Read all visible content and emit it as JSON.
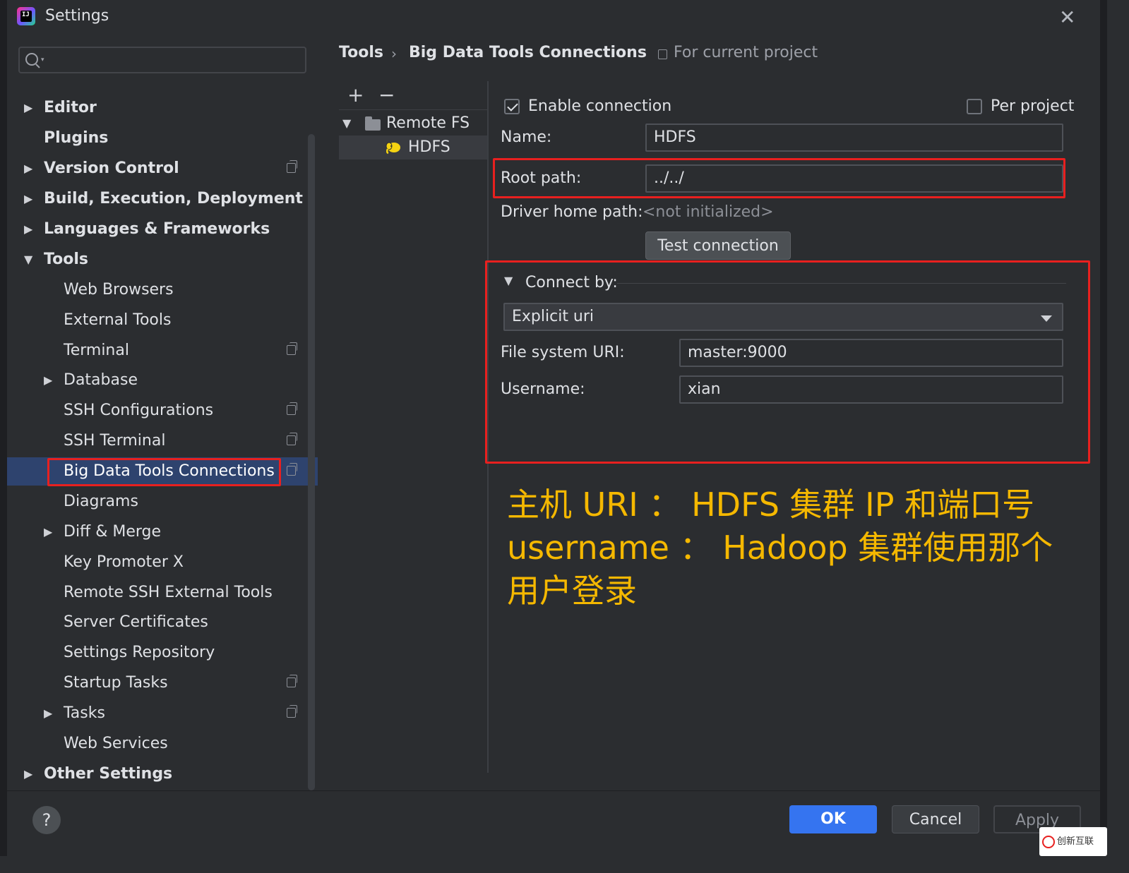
{
  "window": {
    "title": "Settings",
    "app_icon_text": "IJ"
  },
  "search": {
    "value": ""
  },
  "sidebar": {
    "items": [
      {
        "label": "Editor"
      },
      {
        "label": "Plugins"
      },
      {
        "label": "Version Control"
      },
      {
        "label": "Build, Execution, Deployment"
      },
      {
        "label": "Languages & Frameworks"
      },
      {
        "label": "Tools"
      },
      {
        "label": "Web Browsers"
      },
      {
        "label": "External Tools"
      },
      {
        "label": "Terminal"
      },
      {
        "label": "Database"
      },
      {
        "label": "SSH Configurations"
      },
      {
        "label": "SSH Terminal"
      },
      {
        "label": "Big Data Tools Connections"
      },
      {
        "label": "Diagrams"
      },
      {
        "label": "Diff & Merge"
      },
      {
        "label": "Key Promoter X"
      },
      {
        "label": "Remote SSH External Tools"
      },
      {
        "label": "Server Certificates"
      },
      {
        "label": "Settings Repository"
      },
      {
        "label": "Startup Tasks"
      },
      {
        "label": "Tasks"
      },
      {
        "label": "Web Services"
      },
      {
        "label": "Other Settings"
      }
    ]
  },
  "breadcrumb": {
    "parent": "Tools",
    "separator": "›",
    "current": "Big Data Tools Connections",
    "scope": "For current project"
  },
  "connections": {
    "add": "+",
    "remove": "−",
    "group": "Remote FS",
    "item": "HDFS"
  },
  "form": {
    "enable_label": "Enable connection",
    "per_project_label": "Per project",
    "name_label": "Name:",
    "name_value": "HDFS",
    "root_path_label": "Root path:",
    "root_path_value": "../../",
    "driver_label": "Driver home path:",
    "driver_value": "<not initialized>",
    "test_button": "Test connection",
    "connect_by_label": "Connect by:",
    "connect_by_value": "Explicit uri",
    "fs_uri_label": "File system URI:",
    "fs_uri_value": "master:9000",
    "username_label": "Username:",
    "username_value": "xian"
  },
  "annotation": {
    "line1": "主机 URI ： HDFS 集群 IP 和端口号",
    "line2": "username ：  Hadoop 集群使用那个",
    "line3": "用户登录"
  },
  "footer": {
    "help": "?",
    "ok": "OK",
    "cancel": "Cancel",
    "apply": "Apply"
  },
  "watermark": {
    "text": "创新互联"
  },
  "colors": {
    "accent": "#3574f0",
    "highlight": "#e8201f",
    "annotation": "#f5b800",
    "selected_row": "#2e436e"
  }
}
